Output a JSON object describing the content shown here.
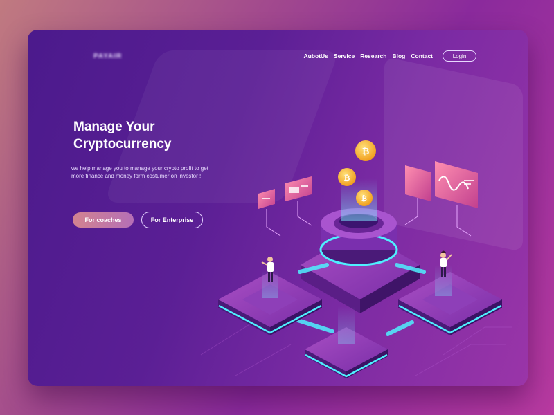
{
  "brand": {
    "logo_text": "PAYAIR"
  },
  "nav": {
    "items": [
      {
        "label": "AubotUs"
      },
      {
        "label": "Service"
      },
      {
        "label": "Research"
      },
      {
        "label": "Blog"
      },
      {
        "label": "Contact"
      }
    ],
    "login_label": "Login"
  },
  "hero": {
    "title_line1": "Manage Your",
    "title_line2": "Cryptocurrency",
    "description": "we help manage you to manage your crypto profit to get more finance and money form costumer on investor !",
    "primary_button": "For coaches",
    "secondary_button": "For Enterprise"
  },
  "illustration": {
    "coin_symbol": "₿",
    "colors": {
      "accent_cyan": "#4ff0ff",
      "coin_gold": "#f7b32b",
      "panel_pink": "#ff6b9e"
    }
  }
}
